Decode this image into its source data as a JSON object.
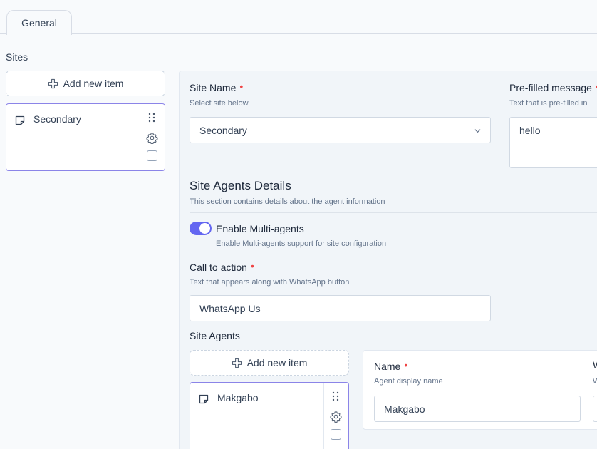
{
  "tabs": [
    {
      "label": "General"
    }
  ],
  "sites": {
    "label": "Sites",
    "add_label": "Add new item",
    "items": [
      {
        "label": "Secondary"
      }
    ]
  },
  "site_form": {
    "site_name": {
      "label": "Site Name",
      "hint": "Select site below",
      "value": "Secondary"
    },
    "prefilled": {
      "label": "Pre-filled message",
      "hint": "Text that is pre-filled in",
      "value": "hello"
    },
    "agents_section": {
      "title": "Site Agents Details",
      "description": "This section contains details about the agent information"
    },
    "multi_agents": {
      "label": "Enable Multi-agents",
      "hint": "Enable Multi-agents support for site configuration",
      "enabled": true
    },
    "call_to_action": {
      "label": "Call to action",
      "hint": "Text that appears along with WhatsApp button",
      "value": "WhatsApp Us"
    },
    "site_agents": {
      "label": "Site Agents",
      "add_label": "Add new item",
      "items": [
        {
          "label": "Makgabo"
        }
      ]
    },
    "agent_form": {
      "name": {
        "label": "Name",
        "hint": "Agent display name",
        "value": "Makgabo"
      },
      "clipped_label": "W",
      "clipped_hint": "W"
    }
  },
  "colors": {
    "accent": "#6366f1",
    "selected_border": "#8b84e8",
    "required": "#ef4444"
  }
}
